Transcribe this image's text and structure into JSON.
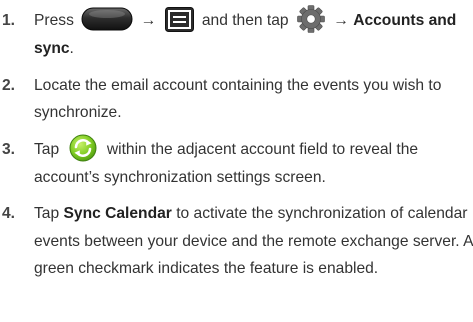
{
  "top_cut_text": "",
  "icons": {
    "home_key": "home-key-icon",
    "menu_key": "menu-key-icon",
    "settings": "gear-icon",
    "sync": "sync-icon"
  },
  "colors": {
    "text": "#333333",
    "icon_dark": "#2a2a2a",
    "sync_green": "#6abf1e"
  },
  "steps": [
    {
      "number": "1.",
      "press": "Press",
      "arrow1": "→",
      "and_then_tap": "and then tap",
      "arrow2": "→",
      "accounts_and": "Accounts and",
      "sync_bold": "sync",
      "period": "."
    },
    {
      "number": "2.",
      "text": "Locate the email account containing the events you wish to synchronize."
    },
    {
      "number": "3.",
      "tap": "Tap",
      "rest": "within the adjacent account field to reveal the account’s synchronization settings screen."
    },
    {
      "number": "4.",
      "tap": "Tap",
      "bold": "Sync Calendar",
      "rest": "to activate the synchronization of calendar events between your device and the remote exchange server. A green checkmark indicates the feature is enabled."
    }
  ]
}
